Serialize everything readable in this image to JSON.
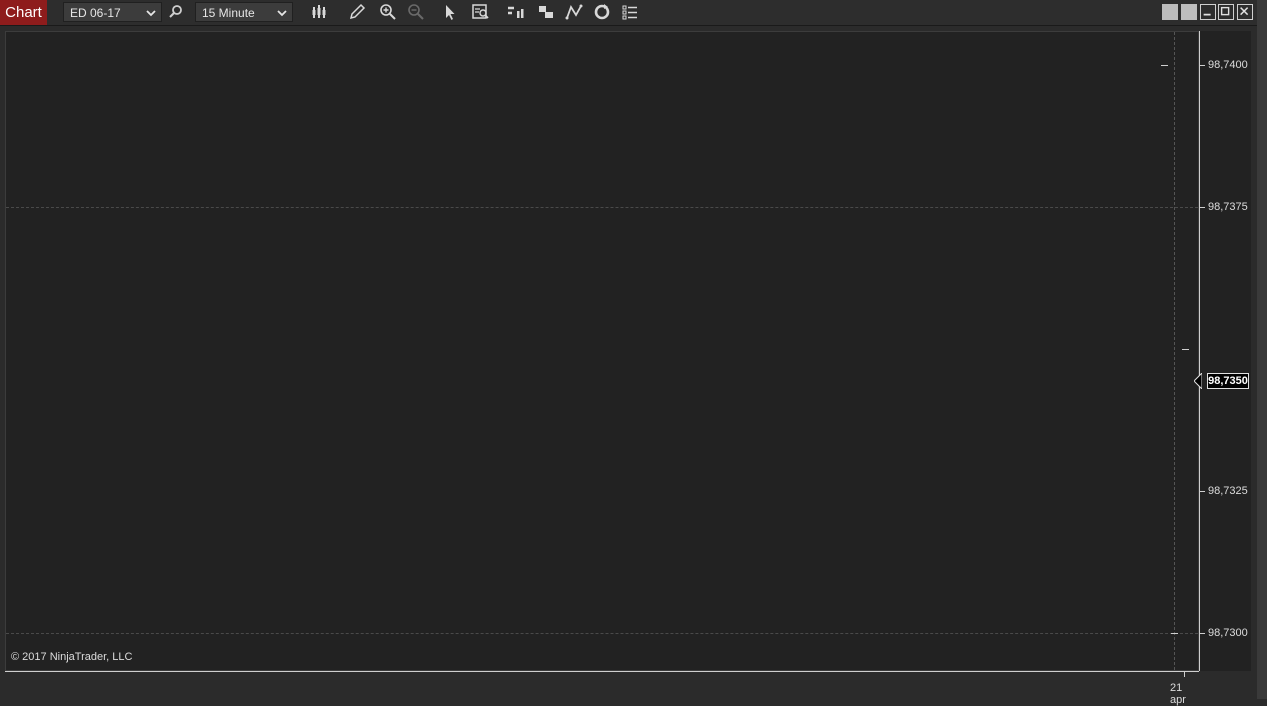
{
  "window": {
    "title": "Chart",
    "colors": {
      "title_tab": "#8e1c1c",
      "background": "#222222",
      "panel": "#2b2b2b",
      "grid": "#4a4a4a",
      "axis_text": "#dcdcdc"
    }
  },
  "toolbar": {
    "instrument": "ED 06-17",
    "interval": "15 Minute",
    "icons": [
      "search-icon",
      "bars-type-icon",
      "pencil-draw-icon",
      "zoom-in-icon",
      "zoom-out-icon",
      "pointer-icon",
      "data-box-icon",
      "bar-chart-icon",
      "stacked-icon",
      "line-tools-icon",
      "refresh-icon",
      "properties-list-icon"
    ]
  },
  "chart": {
    "price_axis": [
      "98,7400",
      "98,7375",
      "98,7350",
      "98,7325",
      "98,7300"
    ],
    "current_price": "98,7350",
    "time_label": "21 apr",
    "copyright": "© 2017 NinjaTrader, LLC"
  },
  "chart_data": {
    "type": "line",
    "ylim": [
      98.73,
      98.74
    ],
    "y_ticks": [
      "98,7400",
      "98,7375",
      "98,7350",
      "98,7325",
      "98,7300"
    ],
    "x_ticks": [
      "21 apr"
    ],
    "current_value": 98.735,
    "grid": true
  }
}
